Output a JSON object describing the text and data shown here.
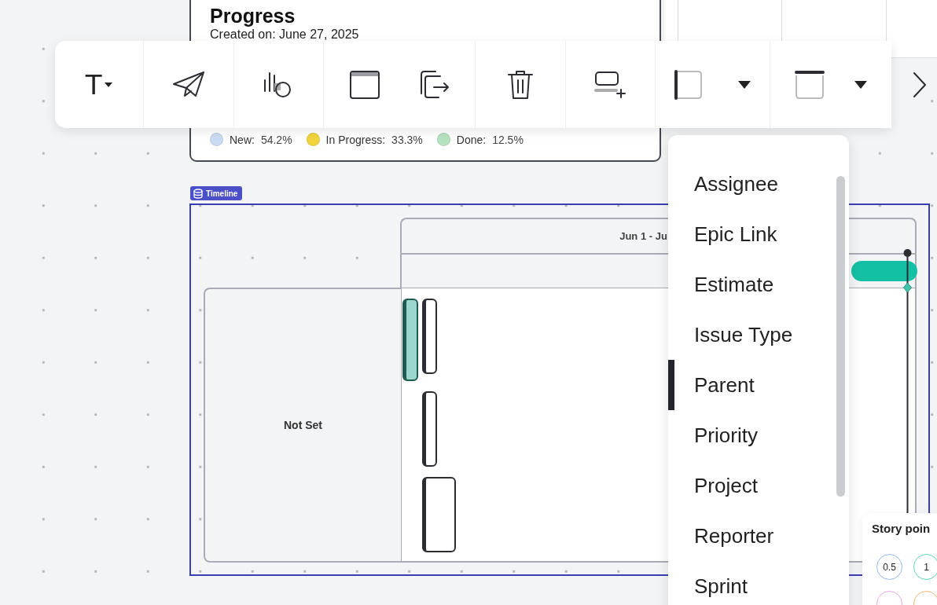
{
  "progress_card": {
    "title": "Progress",
    "created": "Created on:  June 27, 2025",
    "legend": [
      {
        "label": "New:",
        "value": "54.2%",
        "color": "#c9dcf2"
      },
      {
        "label": "In Progress:",
        "value": "33.3%",
        "color": "#f2d43c"
      },
      {
        "label": "Done:",
        "value": "12.5%",
        "color": "#b6e3bf"
      }
    ]
  },
  "toolbar": {
    "groups": [
      {
        "buttons": [
          {
            "kind": "text",
            "label": "T"
          }
        ]
      },
      {
        "buttons": [
          {
            "kind": "send"
          }
        ]
      },
      {
        "buttons": [
          {
            "kind": "chart"
          }
        ]
      },
      {
        "buttons": [
          {
            "kind": "window"
          },
          {
            "kind": "export"
          }
        ]
      },
      {
        "buttons": [
          {
            "kind": "delete"
          }
        ]
      },
      {
        "buttons": [
          {
            "kind": "add-row"
          }
        ]
      },
      {
        "buttons": [
          {
            "kind": "border-left"
          }
        ]
      },
      {
        "buttons": [
          {
            "kind": "border-top"
          }
        ]
      }
    ]
  },
  "timeline": {
    "tag": "Timeline",
    "header": "Jun 1 - Ju",
    "lane": "Not Set",
    "bars": [
      {
        "kind": "filled",
        "color": "#9bd8cb"
      },
      {
        "kind": "outline"
      },
      {
        "kind": "outline"
      },
      {
        "kind": "outline"
      }
    ]
  },
  "field_menu": {
    "items": [
      {
        "label": "Assignee",
        "selected": false
      },
      {
        "label": "Epic Link",
        "selected": false
      },
      {
        "label": "Estimate",
        "selected": false
      },
      {
        "label": "Issue Type",
        "selected": false
      },
      {
        "label": "Parent",
        "selected": true
      },
      {
        "label": "Priority",
        "selected": false
      },
      {
        "label": "Project",
        "selected": false
      },
      {
        "label": "Reporter",
        "selected": false
      },
      {
        "label": "Sprint",
        "selected": false
      }
    ]
  },
  "story_points": {
    "title": "Story poin",
    "chips": [
      {
        "label": "0.5",
        "color": "#8fb8f0"
      },
      {
        "label": "1",
        "color": "#5fd3c0"
      },
      {
        "color": "#e9a3e6"
      },
      {
        "color": "#f3b26b"
      }
    ]
  }
}
